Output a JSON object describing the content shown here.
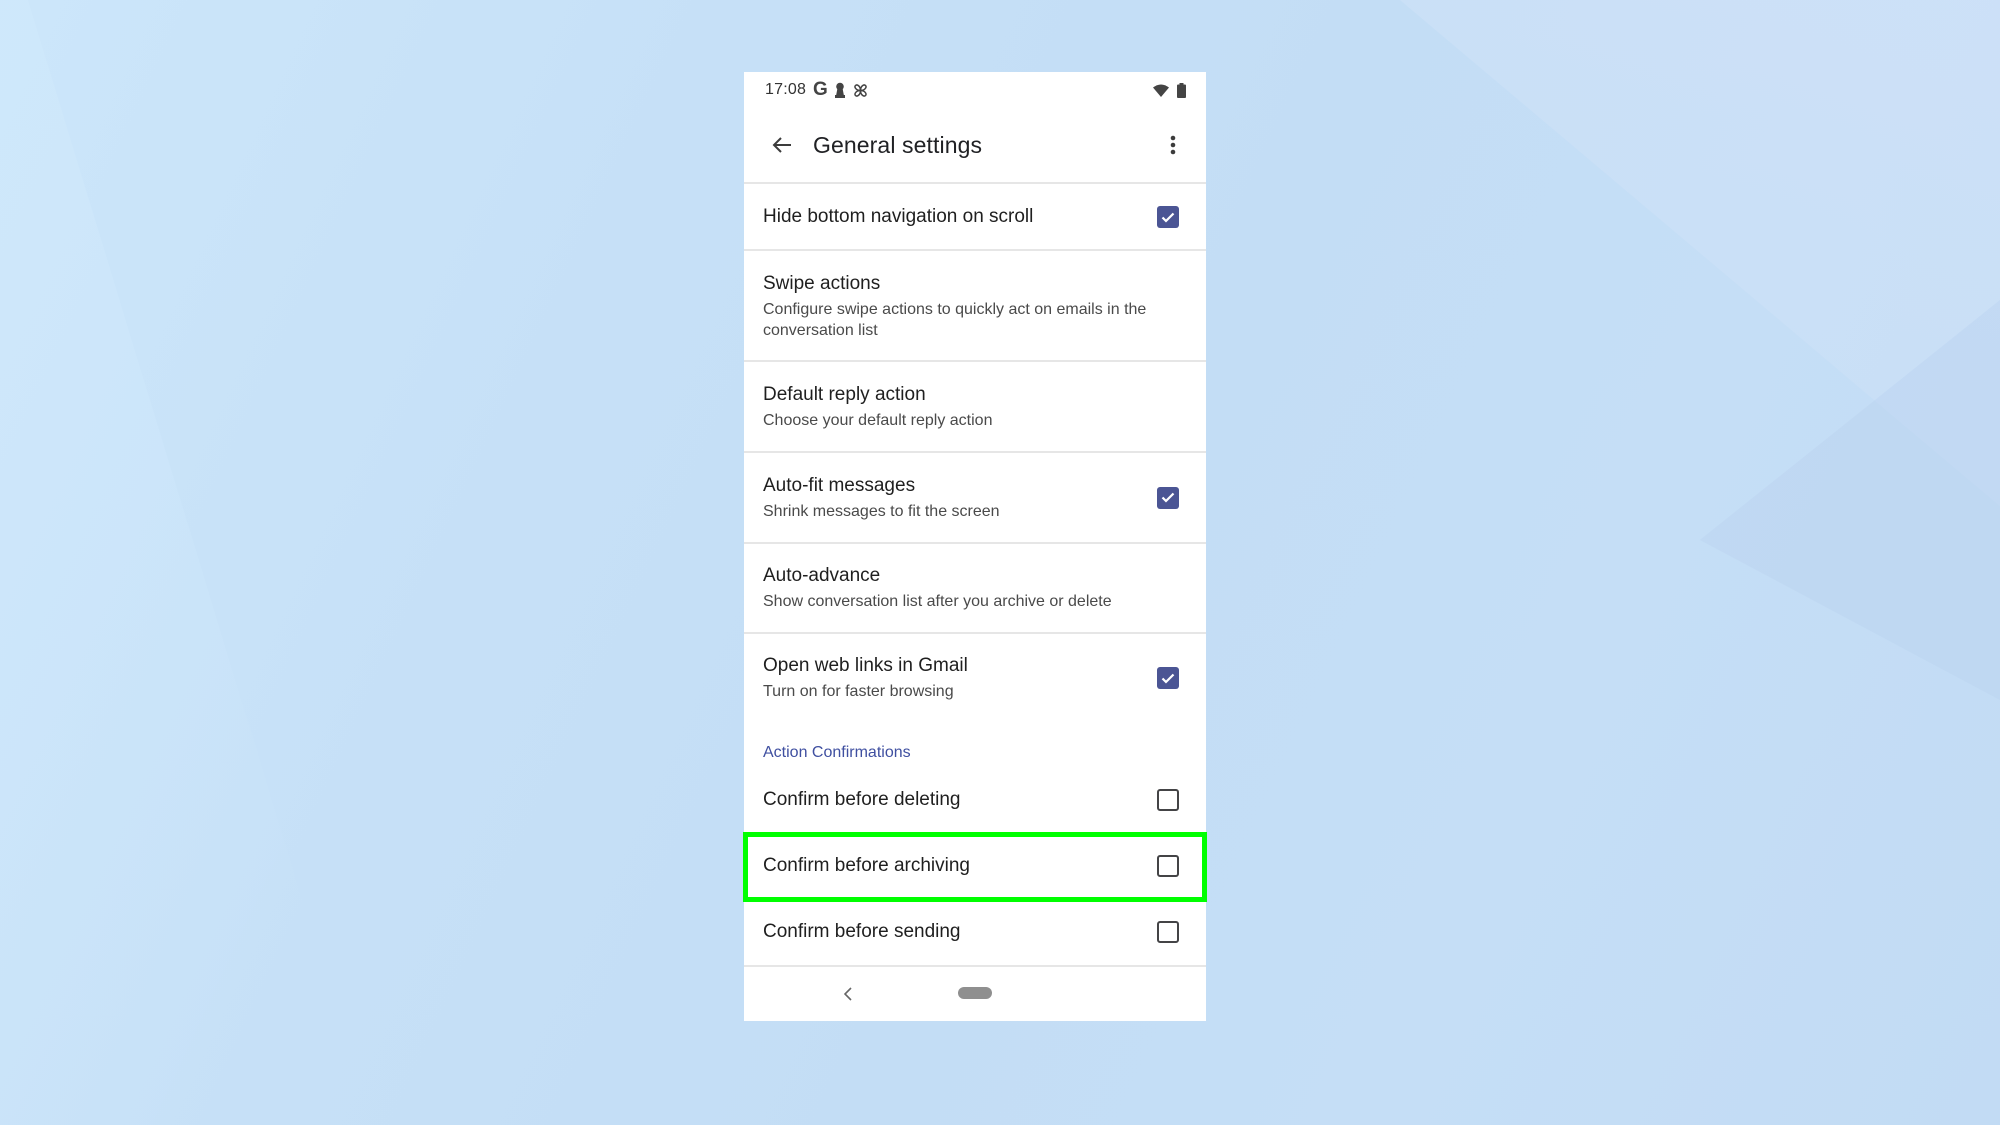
{
  "status_bar": {
    "time": "17:08",
    "left_icons": [
      "google-g-icon",
      "keyhole-icon",
      "pinwheel-icon"
    ],
    "right_icons": [
      "wifi-icon",
      "battery-icon"
    ],
    "google_letter": "G"
  },
  "app_bar": {
    "title": "General settings",
    "back_icon": "arrow-back-icon",
    "more_icon": "more-vert-icon"
  },
  "settings": [
    {
      "title": "Hide bottom navigation on scroll",
      "subtitle": "",
      "checkbox": true,
      "checked": true
    },
    {
      "title": "Swipe actions",
      "subtitle": "Configure swipe actions to quickly act on emails in the conversation list",
      "checkbox": false
    },
    {
      "title": "Default reply action",
      "subtitle": "Choose your default reply action",
      "checkbox": false
    },
    {
      "title": "Auto-fit messages",
      "subtitle": "Shrink messages to fit the screen",
      "checkbox": true,
      "checked": true
    },
    {
      "title": "Auto-advance",
      "subtitle": "Show conversation list after you archive or delete",
      "checkbox": false
    },
    {
      "title": "Open web links in Gmail",
      "subtitle": "Turn on for faster browsing",
      "checkbox": true,
      "checked": true
    }
  ],
  "section": {
    "header": "Action Confirmations",
    "items": [
      {
        "title": "Confirm before deleting",
        "checked": false
      },
      {
        "title": "Confirm before archiving",
        "checked": false,
        "highlighted": true
      },
      {
        "title": "Confirm before sending",
        "checked": false
      }
    ]
  },
  "nav_bar": {
    "back_icon": "nav-back-icon",
    "home_icon": "home-pill-icon"
  },
  "colors": {
    "checkbox_checked": "#4b5594",
    "section_header": "#3f4fa0",
    "highlight": "#00ff00",
    "background": "#c5dff6"
  }
}
